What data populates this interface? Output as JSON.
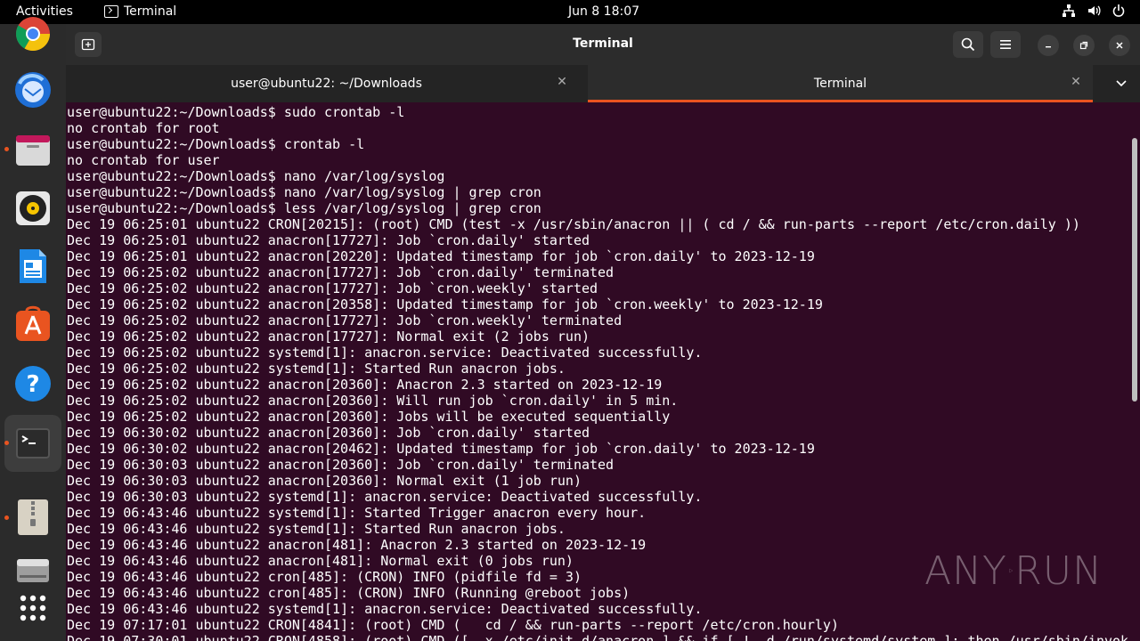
{
  "topbar": {
    "activities": "Activities",
    "app_name": "Terminal",
    "clock": "Jun 8  18:07"
  },
  "dock": {
    "items": [
      "chrome-icon",
      "thunderbird-icon",
      "files-icon",
      "rhythmbox-icon",
      "writer-icon",
      "app-center-icon",
      "help-icon",
      "terminal-icon",
      "archive-icon",
      "drive-icon",
      "show-apps-icon"
    ]
  },
  "window": {
    "title": "Terminal"
  },
  "tabs": [
    {
      "label": "user@ubuntu22: ~/Downloads"
    },
    {
      "label": "Terminal"
    }
  ],
  "terminal": {
    "lines": [
      "user@ubuntu22:~/Downloads$ sudo crontab -l",
      "no crontab for root",
      "user@ubuntu22:~/Downloads$ crontab -l",
      "no crontab for user",
      "user@ubuntu22:~/Downloads$ nano /var/log/syslog",
      "user@ubuntu22:~/Downloads$ nano /var/log/syslog | grep cron",
      "user@ubuntu22:~/Downloads$ less /var/log/syslog | grep cron",
      "Dec 19 06:25:01 ubuntu22 CRON[20215]: (root) CMD (test -x /usr/sbin/anacron || ( cd / && run-parts --report /etc/cron.daily ))",
      "Dec 19 06:25:01 ubuntu22 anacron[17727]: Job `cron.daily' started",
      "Dec 19 06:25:01 ubuntu22 anacron[20220]: Updated timestamp for job `cron.daily' to 2023-12-19",
      "Dec 19 06:25:02 ubuntu22 anacron[17727]: Job `cron.daily' terminated",
      "Dec 19 06:25:02 ubuntu22 anacron[17727]: Job `cron.weekly' started",
      "Dec 19 06:25:02 ubuntu22 anacron[20358]: Updated timestamp for job `cron.weekly' to 2023-12-19",
      "Dec 19 06:25:02 ubuntu22 anacron[17727]: Job `cron.weekly' terminated",
      "Dec 19 06:25:02 ubuntu22 anacron[17727]: Normal exit (2 jobs run)",
      "Dec 19 06:25:02 ubuntu22 systemd[1]: anacron.service: Deactivated successfully.",
      "Dec 19 06:25:02 ubuntu22 systemd[1]: Started Run anacron jobs.",
      "Dec 19 06:25:02 ubuntu22 anacron[20360]: Anacron 2.3 started on 2023-12-19",
      "Dec 19 06:25:02 ubuntu22 anacron[20360]: Will run job `cron.daily' in 5 min.",
      "Dec 19 06:25:02 ubuntu22 anacron[20360]: Jobs will be executed sequentially",
      "Dec 19 06:30:02 ubuntu22 anacron[20360]: Job `cron.daily' started",
      "Dec 19 06:30:02 ubuntu22 anacron[20462]: Updated timestamp for job `cron.daily' to 2023-12-19",
      "Dec 19 06:30:03 ubuntu22 anacron[20360]: Job `cron.daily' terminated",
      "Dec 19 06:30:03 ubuntu22 anacron[20360]: Normal exit (1 job run)",
      "Dec 19 06:30:03 ubuntu22 systemd[1]: anacron.service: Deactivated successfully.",
      "Dec 19 06:43:46 ubuntu22 systemd[1]: Started Trigger anacron every hour.",
      "Dec 19 06:43:46 ubuntu22 systemd[1]: Started Run anacron jobs.",
      "Dec 19 06:43:46 ubuntu22 anacron[481]: Anacron 2.3 started on 2023-12-19",
      "Dec 19 06:43:46 ubuntu22 anacron[481]: Normal exit (0 jobs run)",
      "Dec 19 06:43:46 ubuntu22 cron[485]: (CRON) INFO (pidfile fd = 3)",
      "Dec 19 06:43:46 ubuntu22 cron[485]: (CRON) INFO (Running @reboot jobs)",
      "Dec 19 06:43:46 ubuntu22 systemd[1]: anacron.service: Deactivated successfully.",
      "Dec 19 07:17:01 ubuntu22 CRON[4841]: (root) CMD (   cd / && run-parts --report /etc/cron.hourly)",
      "Dec 19 07:30:01 ubuntu22 CRON[4858]: (root) CMD ([ -x /etc/init.d/anacron ] && if [ ! -d /run/systemd/system ]; then /usr/sbin/invok"
    ]
  },
  "watermark": {
    "left": "ANY",
    "right": "RUN"
  },
  "colors": {
    "terminal_bg": "#300a24",
    "accent": "#e95420"
  }
}
